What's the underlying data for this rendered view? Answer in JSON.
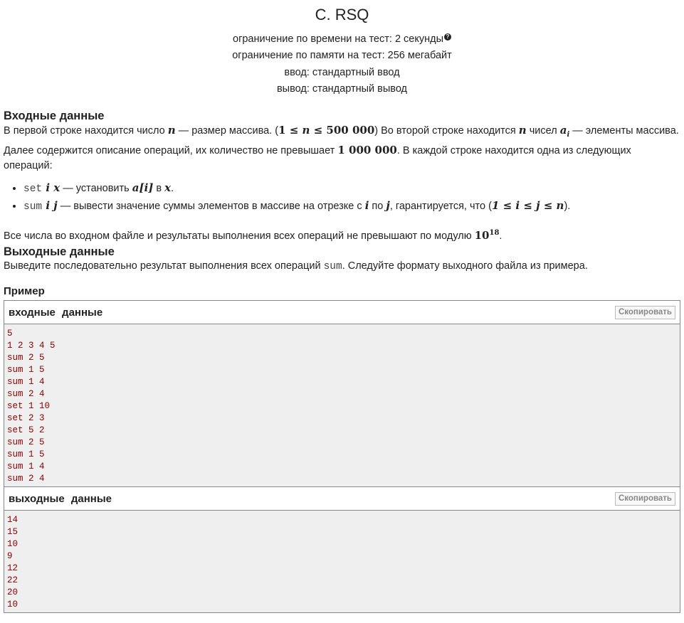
{
  "header": {
    "title": "C. RSQ",
    "time_limit": "ограничение по времени на тест: 2 секунды",
    "memory_limit": "ограничение по памяти на тест: 256 мегабайт",
    "input": "ввод: стандартный ввод",
    "output": "вывод: стандартный вывод"
  },
  "input_section": {
    "heading": "Входные данные",
    "p1_a": "В первой строке находится число ",
    "p1_n": "n",
    "p1_b": " — размер массива. (",
    "p1_ineq": "1 ≤ ",
    "p1_ineq_n": "n",
    "p1_ineq_c": " ≤ 500 000",
    "p1_c": ") Во второй строке находится ",
    "p1_n2": "n",
    "p1_d": " чисел ",
    "p1_ai": "a",
    "p1_ai_sub": "i",
    "p1_e": " — элементы массива. Далее содержится описание операций, их количество не превышает ",
    "p1_max": "1 000 000",
    "p1_f": ". В каждой строке находится одна из следующих операций:",
    "op1_cmd": "set",
    "op1_args": " i x",
    "op1_text": " — установить ",
    "op1_expr": "a[i]",
    "op1_text2": " в ",
    "op1_x": "x",
    "op1_end": ".",
    "op2_cmd": "sum",
    "op2_args": " i j",
    "op2_text": " — вывести значение суммы элементов в массиве на отрезке с ",
    "op2_i": "i",
    "op2_text2": " по ",
    "op2_j": "j",
    "op2_text3": ", гарантируется, что (",
    "op2_ineq": "1 ≤ i ≤ j ≤ n",
    "op2_end": ").",
    "p2": "Все числа во входном файле и результаты выполнения всех операций не превышают по модулю ",
    "p2_base": "10",
    "p2_exp": "18",
    "p2_end": "."
  },
  "output_section": {
    "heading": "Выходные данные",
    "p_a": "Выведите последовательно результат выполнения всех операций ",
    "p_cmd": "sum",
    "p_b": ". Следуйте формату выходного файла из примера."
  },
  "example": {
    "heading": "Пример",
    "input_title": "входные данные",
    "output_title": "выходные данные",
    "copy_label": "Скопировать",
    "input_lines": [
      "5",
      "1 2 3 4 5",
      "sum 2 5",
      "sum 1 5",
      "sum 1 4",
      "sum 2 4",
      "set 1 10",
      "set 2 3",
      "set 5 2",
      "sum 2 5",
      "sum 1 5",
      "sum 1 4",
      "sum 2 4"
    ],
    "output_lines": [
      "14",
      "15",
      "10",
      "9",
      "12",
      "22",
      "20",
      "10"
    ]
  }
}
